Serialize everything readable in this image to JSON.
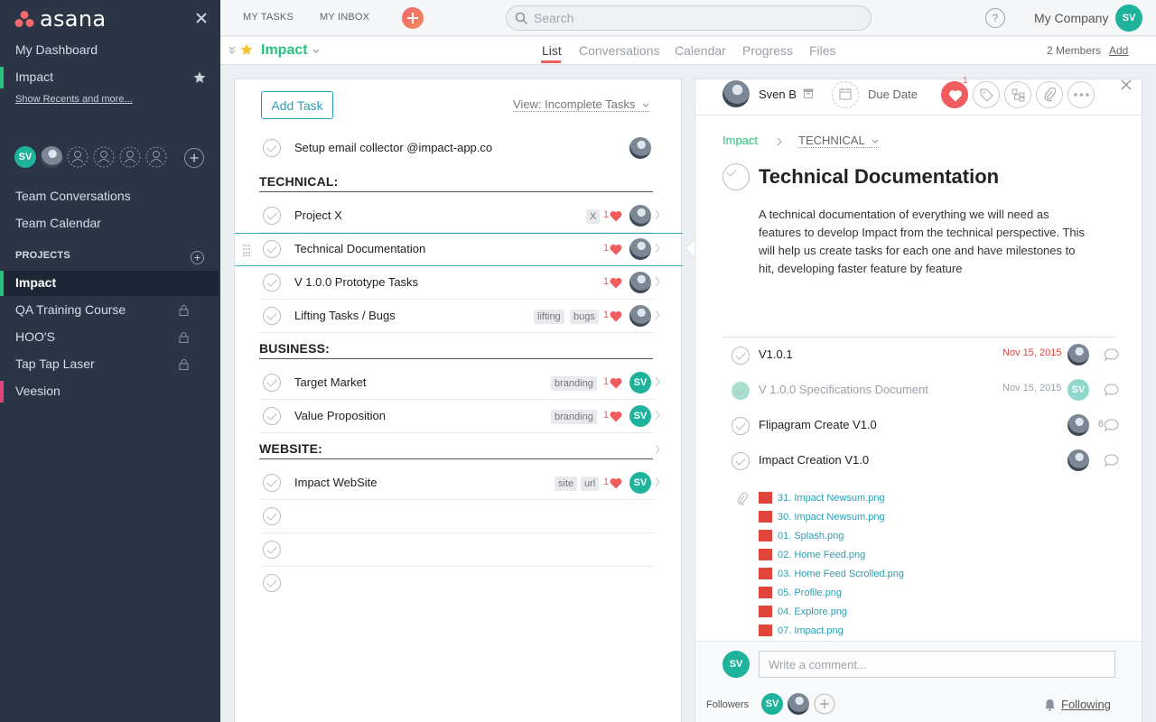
{
  "brand": {
    "name": "asana"
  },
  "sidebar": {
    "dashboard": "My Dashboard",
    "favorite": "Impact",
    "show_recents": "Show Recents and more...",
    "team_initials": "SV",
    "team_links": [
      "Team Conversations",
      "Team Calendar"
    ],
    "projects_heading": "PROJECTS",
    "projects": [
      {
        "label": "Impact",
        "locked": false,
        "color": "#27c27e"
      },
      {
        "label": "QA Training Course",
        "locked": true,
        "color": ""
      },
      {
        "label": "HOO'S",
        "locked": true,
        "color": ""
      },
      {
        "label": "Tap Tap Laser",
        "locked": true,
        "color": ""
      },
      {
        "label": "Veesion",
        "locked": false,
        "color": "#e0447c"
      }
    ]
  },
  "topbar": {
    "my_tasks": "MY TASKS",
    "my_inbox": "MY INBOX",
    "search_placeholder": "Search",
    "help": "?",
    "company": "My Company",
    "user_initials": "SV"
  },
  "project_bar": {
    "title": "Impact",
    "tabs": [
      "List",
      "Conversations",
      "Calendar",
      "Progress",
      "Files"
    ],
    "active_tab": "List",
    "members": "2 Members",
    "add": "Add"
  },
  "task_list": {
    "add_task": "Add Task",
    "view": "View: Incomplete Tasks",
    "first_task": {
      "name": "Setup email collector @impact-app.co"
    },
    "sections": [
      {
        "title": "TECHNICAL:",
        "tasks": [
          {
            "name": "Project X",
            "tags": [
              "X"
            ],
            "likes": "1"
          },
          {
            "name": "Technical Documentation",
            "tags": [],
            "likes": "1"
          },
          {
            "name": "V 1.0.0 Prototype Tasks",
            "tags": [],
            "likes": "1"
          },
          {
            "name": "Lifting Tasks / Bugs",
            "tags": [
              "lifting",
              "bugs"
            ],
            "likes": "1"
          }
        ]
      },
      {
        "title": "BUSINESS:",
        "tasks": [
          {
            "name": "Target Market",
            "tags": [
              "branding"
            ],
            "likes": "1",
            "assignee": "SV"
          },
          {
            "name": "Value Proposition",
            "tags": [
              "branding"
            ],
            "likes": "1",
            "assignee": "SV"
          }
        ]
      },
      {
        "title": "WEBSITE:",
        "tasks": [
          {
            "name": "Impact WebSite",
            "tags": [
              "site",
              "url"
            ],
            "likes": "1",
            "assignee": "SV"
          }
        ]
      }
    ]
  },
  "detail": {
    "assignee": "Sven B",
    "due_date": "Due Date",
    "heart_count": "1",
    "breadcrumb_project": "Impact",
    "breadcrumb_section": "TECHNICAL",
    "title": "Technical Documentation",
    "description": "A technical documentation of everything we will need as features to develop Impact from the technical perspective. This will help us create tasks for each one and have milestones to hit, developing faster feature by feature",
    "subtasks": [
      {
        "name": "V1.0.1",
        "date": "Nov 15, 2015",
        "date_color": "#e0443b",
        "done": false
      },
      {
        "name": "V 1.0.0 Specifications Document",
        "date": "Nov 15, 2015",
        "date_color": "#9aa0a8",
        "done": true
      },
      {
        "name": "Flipagram Create V1.0",
        "date": "",
        "count": "6",
        "done": false
      },
      {
        "name": "Impact Creation V1.0",
        "date": "",
        "done": false
      }
    ],
    "attachments": [
      "31. Impact Newsum.png",
      "30. Impact Newsum.png",
      "01. Splash.png",
      "02. Home Feed.png",
      "03. Home Feed Scrolled.png",
      "05. Profile.png",
      "04. Explore.png",
      "07. Impact.png"
    ],
    "comment_placeholder": "Write a comment...",
    "followers_label": "Followers",
    "follower_initials": "SV",
    "following": "Following"
  },
  "colors": {
    "accent": "#27c27e",
    "heart": "#f05c5f",
    "link": "#2b9fb3",
    "sidebar": "#2b3546"
  }
}
